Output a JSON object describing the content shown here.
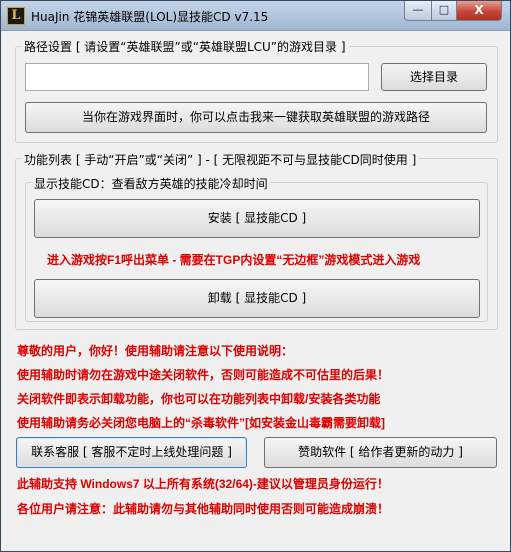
{
  "window": {
    "title": "HuaJin 花锦英雄联盟(LOL)显技能CD v7.15",
    "icon_glyph": "L",
    "min_glyph": "—",
    "max_glyph": "□",
    "close_glyph": "X"
  },
  "path_group": {
    "label": "路径设置 [ 请设置“英雄联盟”或“英雄联盟LCU”的游戏目录 ]",
    "input_value": "",
    "browse_label": "选择目录",
    "auto_path_label": "当你在游戏界面时，你可以点击我来一键获取英雄联盟的游戏路径"
  },
  "feature_group": {
    "label": "功能列表 [ 手动“开启”或“关闭” ] - [ 无限视距不可与显技能CD同时使用 ]",
    "sub_label": "显示技能CD：查看敌方英雄的技能冷却时间",
    "install_label": "安装 [ 显技能CD ]",
    "notice": "进入游戏按F1呼出菜单 - 需要在TGP内设置“无边框”游戏模式进入游戏",
    "uninstall_label": "卸载 [ 显技能CD ]"
  },
  "notes": [
    "尊敬的用户，你好！使用辅助请注意以下使用说明：",
    "使用辅助时请勿在游戏中途关闭软件，否则可能造成不可估里的后果！",
    "关闭软件即表示卸载功能，你也可以在功能列表中卸载/安装各类功能",
    "使用辅助请务必关闭您电脑上的“杀毒软件”[如安装金山毒霸需要卸载]"
  ],
  "support_label": "联系客服 [ 客服不定时上线处理问题 ]",
  "sponsor_label": "赞助软件 [ 给作者更新的动力 ]",
  "footer_notes": [
    "此辅助支持 Windows7 以上所有系统(32/64)-建议以管理员身份运行！",
    "各位用户请注意：此辅助请勿与其他辅助同时使用否则可能造成崩溃！"
  ]
}
